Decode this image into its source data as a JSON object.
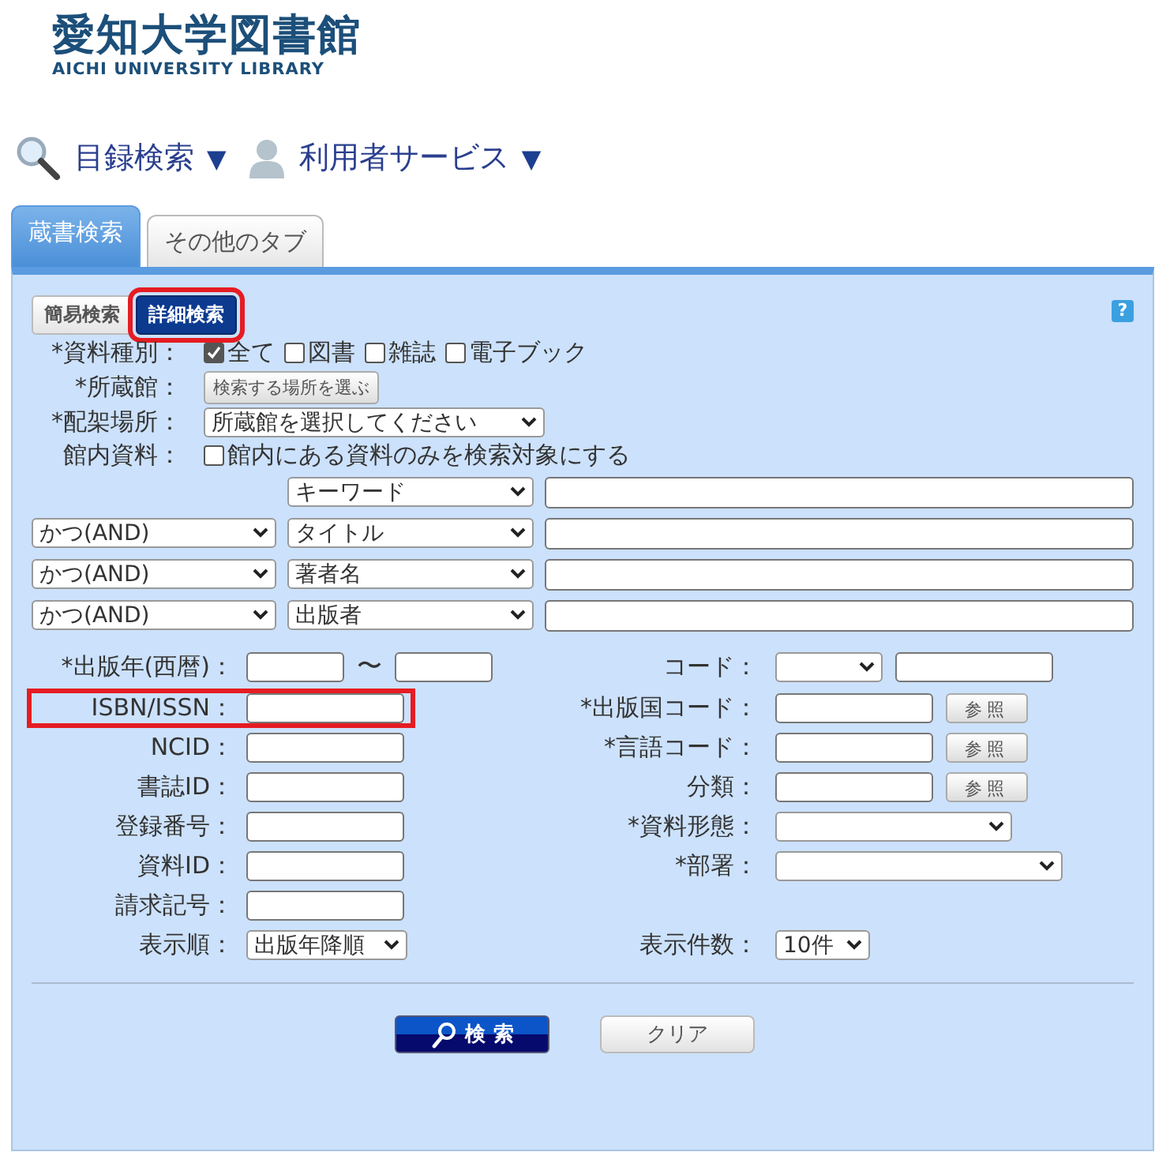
{
  "logo": {
    "title": "愛知大学図書館",
    "subtitle": "AICHI UNIVERSITY LIBRARY"
  },
  "nav": [
    {
      "label": "目録検索",
      "caret": "▼"
    },
    {
      "label": "利用者サービス",
      "caret": "▼"
    }
  ],
  "tabs": [
    {
      "label": "蔵書検索",
      "selected": true
    },
    {
      "label": "その他のタブ",
      "selected": false
    }
  ],
  "modes": [
    {
      "label": "簡易検索",
      "selected": false,
      "highlighted": false
    },
    {
      "label": "詳細検索",
      "selected": true,
      "highlighted": true
    }
  ],
  "help": "?",
  "material_type": {
    "label": "*資料種別：",
    "options": [
      {
        "label": "全て",
        "checked": true
      },
      {
        "label": "図書",
        "checked": false
      },
      {
        "label": "雑誌",
        "checked": false
      },
      {
        "label": "電子ブック",
        "checked": false
      }
    ]
  },
  "library": {
    "label": "*所蔵館：",
    "button": "検索する場所を選ぶ"
  },
  "location": {
    "label": "*配架場所：",
    "value": "所蔵館を選択してください"
  },
  "in_library": {
    "label": "館内資料：",
    "option": "館内にある資料のみを検索対象にする",
    "checked": false
  },
  "keyword_rows": [
    {
      "field": "キーワード"
    },
    {
      "operator": "かつ(AND)",
      "field": "タイトル"
    },
    {
      "operator": "かつ(AND)",
      "field": "著者名"
    },
    {
      "operator": "かつ(AND)",
      "field": "出版者"
    }
  ],
  "fields_left": [
    {
      "label": "*出版年(西暦)：",
      "kind": "range",
      "separator": "〜",
      "highlighted": false
    },
    {
      "label": "ISBN/ISSN：",
      "kind": "text",
      "highlighted": true
    },
    {
      "label": "NCID：",
      "kind": "text",
      "highlighted": false
    },
    {
      "label": "書誌ID：",
      "kind": "text",
      "highlighted": false
    },
    {
      "label": "登録番号：",
      "kind": "text",
      "highlighted": false
    },
    {
      "label": "資料ID：",
      "kind": "text",
      "highlighted": false
    },
    {
      "label": "請求記号：",
      "kind": "text",
      "highlighted": false
    },
    {
      "label": "表示順：",
      "kind": "select",
      "value": "出版年降順",
      "highlighted": false
    }
  ],
  "fields_right": [
    {
      "label": "コード：",
      "kind": "selecttext"
    },
    {
      "label": "*出版国コード：",
      "kind": "textbutton",
      "button": "参照"
    },
    {
      "label": "*言語コード：",
      "kind": "textbutton",
      "button": "参照"
    },
    {
      "label": "分類：",
      "kind": "textbutton",
      "button": "参照"
    },
    {
      "label": "*資料形態：",
      "kind": "select"
    },
    {
      "label": "*部署：",
      "kind": "wideselect"
    },
    {
      "kind": "none"
    },
    {
      "label": "表示件数：",
      "kind": "smallselect",
      "value": "10件"
    }
  ],
  "actions": {
    "search": "検 索",
    "clear": "クリア"
  }
}
